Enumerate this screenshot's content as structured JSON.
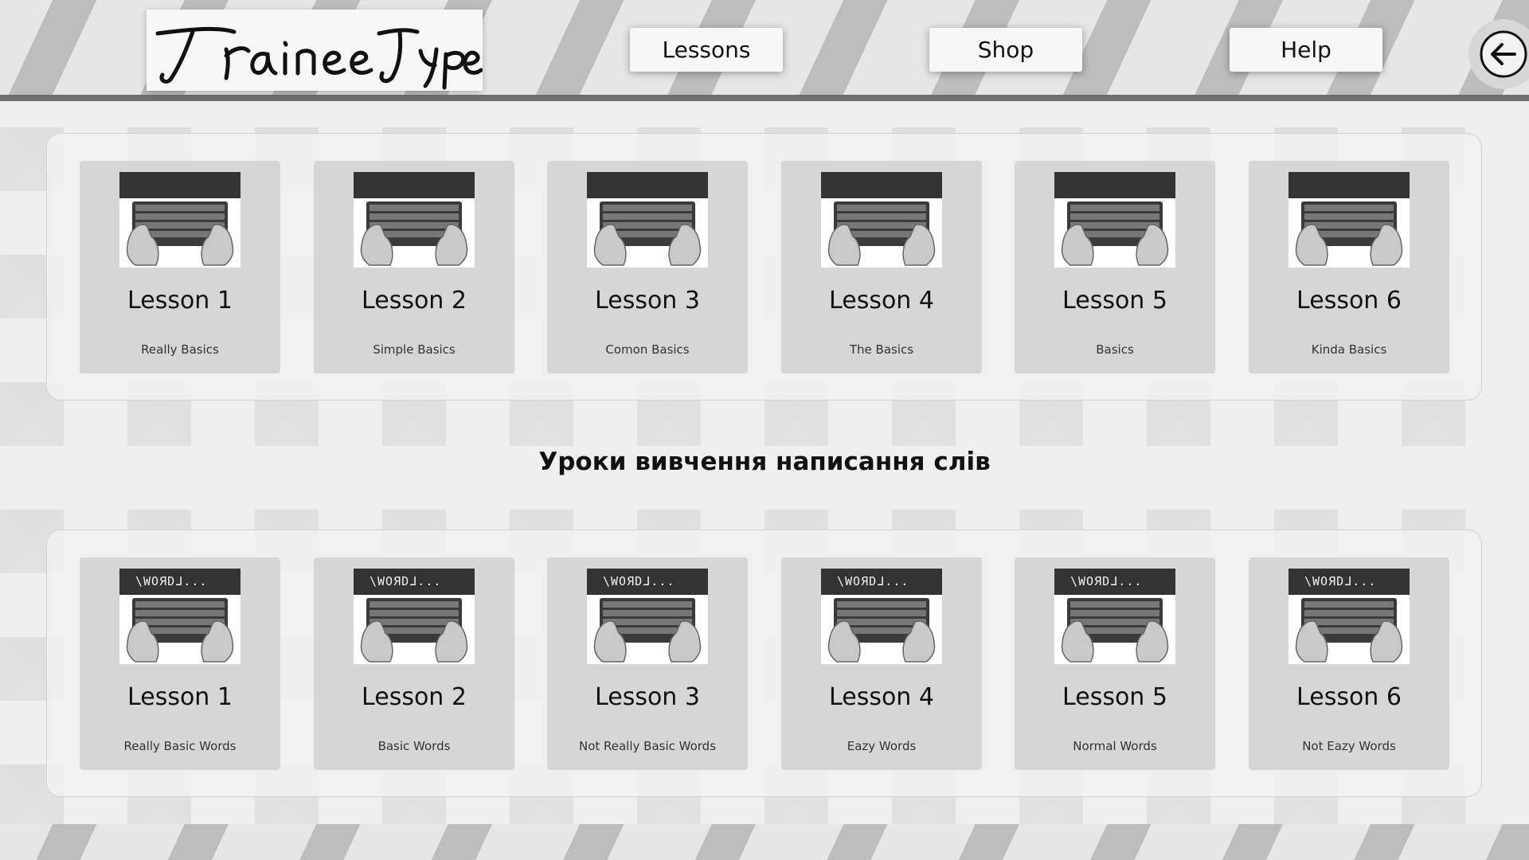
{
  "header": {
    "logo_text": "TraineeType",
    "nav": {
      "lessons": "Lessons",
      "shop": "Shop",
      "help": "Help"
    },
    "back_icon": "arrow-left-circle-icon"
  },
  "basics_section": {
    "lessons": [
      {
        "title": "Lesson 1",
        "subtitle": "Really Basics"
      },
      {
        "title": "Lesson 2",
        "subtitle": "Simple Basics"
      },
      {
        "title": "Lesson 3",
        "subtitle": "Comon Basics"
      },
      {
        "title": "Lesson 4",
        "subtitle": "The Basics"
      },
      {
        "title": "Lesson 5",
        "subtitle": "Basics"
      },
      {
        "title": "Lesson 6",
        "subtitle": "Kinda Basics"
      }
    ]
  },
  "words_section": {
    "heading": "Уроки вивчення написання слів",
    "thumb_text": "\\WOЯDᒧ...",
    "lessons": [
      {
        "title": "Lesson 1",
        "subtitle": "Really Basic Words"
      },
      {
        "title": "Lesson 2",
        "subtitle": "Basic Words"
      },
      {
        "title": "Lesson 3",
        "subtitle": "Not Really Basic Words"
      },
      {
        "title": "Lesson 4",
        "subtitle": "Eazy Words"
      },
      {
        "title": "Lesson 5",
        "subtitle": "Normal Words"
      },
      {
        "title": "Lesson 6",
        "subtitle": "Not Eazy Words"
      }
    ]
  },
  "colors": {
    "background": "#efefef",
    "card": "#d6d6d6",
    "dark_bar": "#333333",
    "header_rule": "#6f6f6f"
  }
}
